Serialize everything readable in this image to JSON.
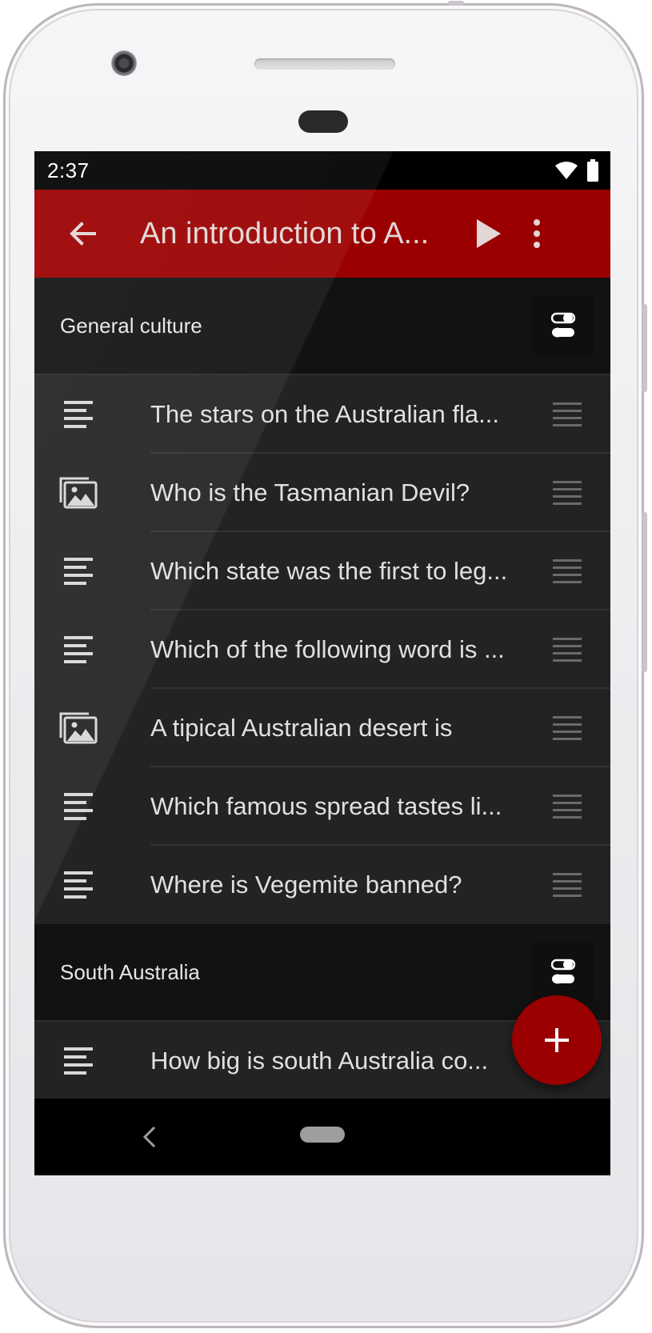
{
  "status_bar": {
    "time": "2:37"
  },
  "app_bar": {
    "title": "An introduction to A...",
    "accent": "#9b0000"
  },
  "sections": [
    {
      "title": "General culture",
      "items": [
        {
          "type": "text",
          "icon": "text-lines-icon",
          "label": "The stars on the Australian fla..."
        },
        {
          "type": "image",
          "icon": "image-icon",
          "label": "Who is the Tasmanian Devil?"
        },
        {
          "type": "text",
          "icon": "text-lines-icon",
          "label": "Which state was the first to leg..."
        },
        {
          "type": "text",
          "icon": "text-lines-icon",
          "label": "Which of the following word is ..."
        },
        {
          "type": "image",
          "icon": "image-icon",
          "label": "A tipical Australian desert is"
        },
        {
          "type": "text",
          "icon": "text-lines-icon",
          "label": "Which famous spread tastes li..."
        },
        {
          "type": "text",
          "icon": "text-lines-icon",
          "label": "Where is Vegemite banned?"
        }
      ]
    },
    {
      "title": "South Australia",
      "items": [
        {
          "type": "text",
          "icon": "text-lines-icon",
          "label": "How big is south Australia co..."
        }
      ]
    }
  ],
  "fab": {
    "icon": "plus-icon"
  },
  "colors": {
    "background": "#232324",
    "header": "#121213",
    "text": "#e0e0e0"
  }
}
